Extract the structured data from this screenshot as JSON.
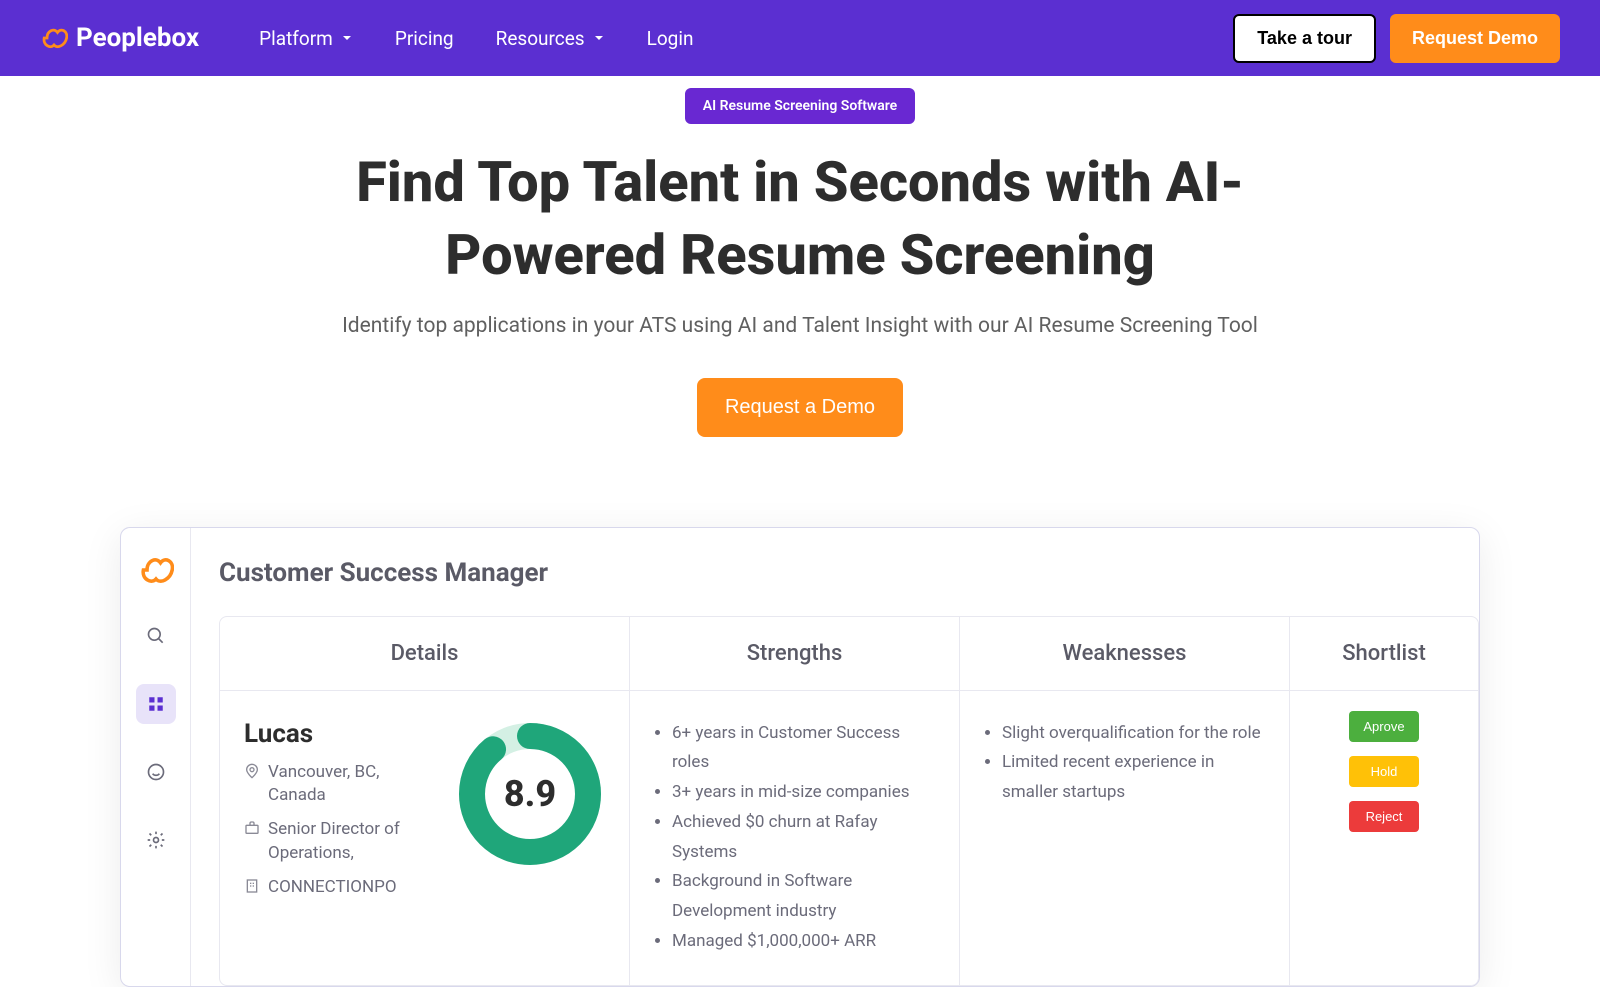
{
  "brand": "Peoplebox",
  "nav": {
    "platform": "Platform",
    "pricing": "Pricing",
    "resources": "Resources",
    "login": "Login",
    "tour": "Take a tour",
    "demo": "Request Demo"
  },
  "hero": {
    "badge": "AI Resume Screening Software",
    "title": "Find Top Talent in Seconds with AI-Powered Resume Screening",
    "subtitle": "Identify top applications in your ATS using AI and Talent Insight with our AI Resume Screening Tool",
    "cta": "Request a Demo"
  },
  "preview": {
    "title": "Customer Success Manager",
    "columns": {
      "details": "Details",
      "strengths": "Strengths",
      "weaknesses": "Weaknesses",
      "shortlist": "Shortlist"
    },
    "candidate": {
      "name": "Lucas",
      "location": "Vancouver, BC, Canada",
      "role": "Senior Director of Operations,",
      "company": "CONNECTIONPO",
      "score": "8.9",
      "strengths": [
        "6+ years in Customer Success roles",
        "3+ years in mid-size companies",
        "Achieved $0 churn at Rafay Systems",
        "Background in Software Development industry",
        "Managed $1,000,000+ ARR"
      ],
      "weaknesses": [
        "Slight overqualification for the role",
        "Limited recent experience in smaller startups"
      ]
    },
    "actions": {
      "approve": "Aprove",
      "hold": "Hold",
      "reject": "Reject"
    }
  }
}
